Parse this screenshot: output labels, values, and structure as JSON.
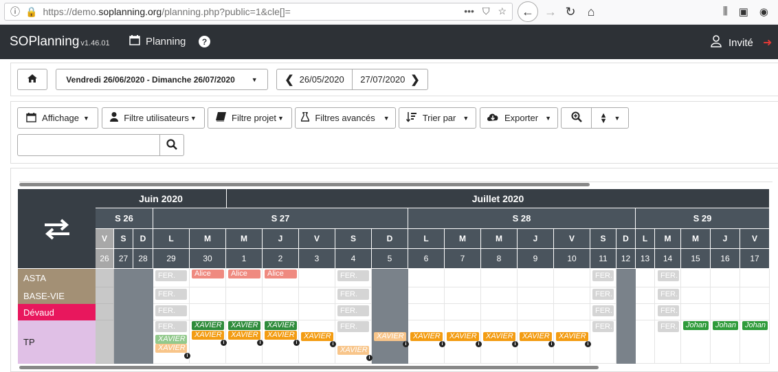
{
  "browser": {
    "url_prefix": "https://demo.",
    "url_domain": "soplanning.org",
    "url_suffix": "/planning.php?public=1&cle[]="
  },
  "navbar": {
    "brand": "SOPlanning",
    "version": "v1.46.01",
    "planning_label": "Planning",
    "user_label": "Invité"
  },
  "toolbar": {
    "date_range": "Vendredi 26/06/2020 - Dimanche 26/07/2020",
    "prev_date": "26/05/2020",
    "next_date": "27/07/2020"
  },
  "filters": {
    "affichage": "Affichage",
    "filtre_utilisateurs": "Filtre utilisateurs",
    "filtre_projet": "Filtre projet",
    "filtres_avances": "Filtres avancés",
    "trier_par": "Trier par",
    "exporter": "Exporter",
    "search_value": ""
  },
  "planning": {
    "months": [
      {
        "label": "Juin 2020"
      },
      {
        "label": "Juillet 2020"
      }
    ],
    "weeks": [
      "S 26",
      "S 27",
      "S 28",
      "S 29"
    ],
    "day_letters": [
      "V",
      "S",
      "D",
      "L",
      "M",
      "M",
      "J",
      "V",
      "S",
      "D",
      "L",
      "M",
      "M",
      "J",
      "V",
      "S",
      "D",
      "L",
      "M",
      "M",
      "J",
      "V"
    ],
    "day_numbers": [
      "26",
      "27",
      "28",
      "29",
      "30",
      "1",
      "2",
      "3",
      "4",
      "5",
      "6",
      "7",
      "8",
      "9",
      "10",
      "11",
      "12",
      "13",
      "14",
      "15",
      "16",
      "17"
    ],
    "rows": [
      {
        "label": "ASTA",
        "color": "#a39075"
      },
      {
        "label": "BASE-VIE",
        "color": "#a39075"
      },
      {
        "label": "Dévaud",
        "color": "#e8175d"
      },
      {
        "label": "TP",
        "color": "#e0c0e6"
      }
    ],
    "tags": {
      "fer": "FER.",
      "alice": "Alice",
      "xavier": "XAVIER",
      "johan": "Johan"
    }
  }
}
